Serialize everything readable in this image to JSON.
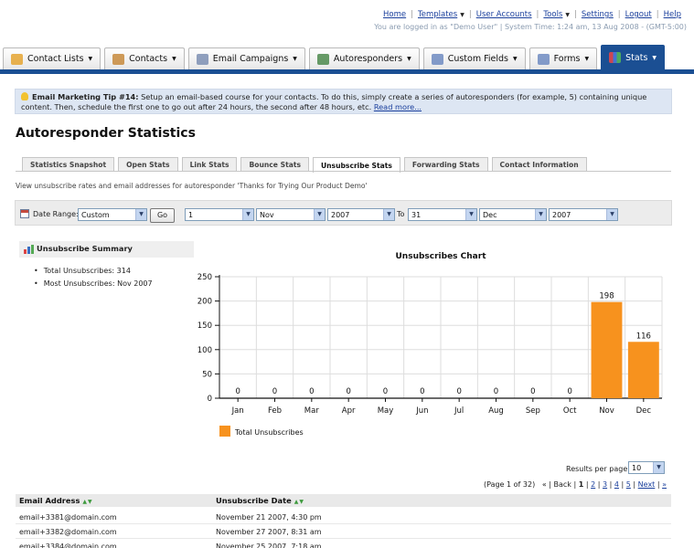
{
  "top_links": [
    {
      "label": "Home",
      "caret": false
    },
    {
      "label": "Templates",
      "caret": true
    },
    {
      "label": "User Accounts",
      "caret": false
    },
    {
      "label": "Tools",
      "caret": true
    },
    {
      "label": "Settings",
      "caret": false
    },
    {
      "label": "Logout",
      "caret": false
    },
    {
      "label": "Help",
      "caret": false
    }
  ],
  "login_info": "You are logged in as \"Demo User\" | System Time: 1:24 am, 13 Aug 2008 - (GMT-5:00)",
  "nav_tabs": [
    {
      "label": "Contact Lists",
      "icon": "contact-lists-icon"
    },
    {
      "label": "Contacts",
      "icon": "contacts-icon"
    },
    {
      "label": "Email Campaigns",
      "icon": "envelope-icon"
    },
    {
      "label": "Autoresponders",
      "icon": "autoresponder-icon"
    },
    {
      "label": "Custom Fields",
      "icon": "custom-fields-icon"
    },
    {
      "label": "Forms",
      "icon": "forms-icon"
    },
    {
      "label": "Stats",
      "icon": "stats-icon",
      "active": true
    }
  ],
  "tip": {
    "title": "Email Marketing Tip #14:",
    "text": "Setup an email-based course for your contacts. To do this, simply create a series of autoresponders (for example, 5) containing unique content. Then, schedule the first one to go out after 24 hours, the second after 48 hours, etc.",
    "link": "Read more..."
  },
  "page_title": "Autoresponder Statistics",
  "sub_tabs": [
    {
      "label": "Statistics Snapshot"
    },
    {
      "label": "Open Stats"
    },
    {
      "label": "Link Stats"
    },
    {
      "label": "Bounce Stats"
    },
    {
      "label": "Unsubscribe Stats",
      "active": true
    },
    {
      "label": "Forwarding Stats"
    },
    {
      "label": "Contact Information"
    }
  ],
  "description": "View unsubscribe rates and email addresses for autoresponder 'Thanks for Trying Our Product Demo'",
  "date_range": {
    "label": "Date Range:",
    "preset": "Custom",
    "go_label": "Go",
    "from_day": "1",
    "from_month": "Nov",
    "from_year": "2007",
    "to_label": "To",
    "to_day": "31",
    "to_month": "Dec",
    "to_year": "2007"
  },
  "summary": {
    "heading": "Unsubscribe Summary",
    "items": [
      "Total Unsubscribes: 314",
      "Most Unsubscribes: Nov 2007"
    ]
  },
  "chart_data": {
    "type": "bar",
    "title": "Unsubscribes Chart",
    "categories": [
      "Jan",
      "Feb",
      "Mar",
      "Apr",
      "May",
      "Jun",
      "Jul",
      "Aug",
      "Sep",
      "Oct",
      "Nov",
      "Dec"
    ],
    "series": [
      {
        "name": "Total Unsubscribes",
        "values": [
          0,
          0,
          0,
          0,
          0,
          0,
          0,
          0,
          0,
          0,
          198,
          116
        ],
        "color": "#f7921e"
      }
    ],
    "yticks": [
      0,
      50,
      100,
      150,
      200,
      250
    ],
    "ylim": [
      0,
      250
    ],
    "grid": true,
    "legend": "bottom-left"
  },
  "results_per_page": {
    "label": "Results per page:",
    "value": "10"
  },
  "pager": {
    "info": "(Page 1 of 32)",
    "prev": "« | Back |",
    "pages": [
      "1",
      "2",
      "3",
      "4",
      "5"
    ],
    "next": "Next",
    "last": "»"
  },
  "table": {
    "columns": [
      "Email Address",
      "Unsubscribe Date"
    ],
    "rows": [
      [
        "email+3381@domain.com",
        "November 21 2007, 4:30 pm"
      ],
      [
        "email+3382@domain.com",
        "November 27 2007, 8:31 am"
      ],
      [
        "email+3384@domain.com",
        "November 25 2007, 7:18 am"
      ]
    ]
  }
}
